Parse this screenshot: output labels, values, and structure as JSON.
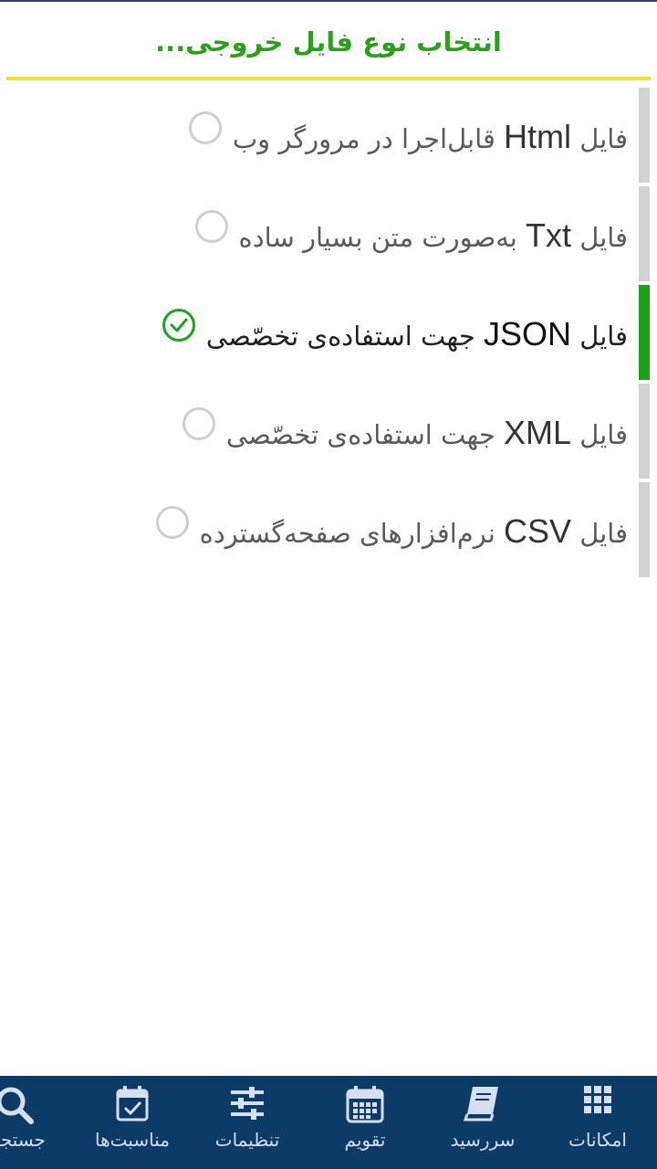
{
  "header": {
    "title": "انتخاب نوع فایل خروجی..."
  },
  "options": [
    {
      "prefix": "فایل ",
      "latin": "Html",
      "suffix": " قابل‌اجرا در مرورگر وب",
      "selected": false
    },
    {
      "prefix": "فایل ",
      "latin": "Txt",
      "suffix": " به‌صورت متن بسیار ساده",
      "selected": false
    },
    {
      "prefix": "فایل ",
      "latin": "JSON",
      "suffix": " جهت استفاده‌ی تخصّصی",
      "selected": true
    },
    {
      "prefix": "فایل ",
      "latin": "XML",
      "suffix": " جهت استفاده‌ی تخصّصی",
      "selected": false
    },
    {
      "prefix": "فایل ",
      "latin": "CSV",
      "suffix": " نرم‌افزارهای صفحه‌گسترده",
      "selected": false
    }
  ],
  "bottom_nav": {
    "items": [
      {
        "label": "امکانات",
        "icon": "grid-icon"
      },
      {
        "label": "سررسید",
        "icon": "book-icon"
      },
      {
        "label": "تقویم",
        "icon": "calendar-icon"
      },
      {
        "label": "تنظیمات",
        "icon": "sliders-icon"
      },
      {
        "label": "مناسبت‌ها",
        "icon": "calendar-check-icon"
      },
      {
        "label": "جستجو",
        "icon": "search-icon"
      }
    ]
  },
  "colors": {
    "accent_green": "#2e9e1f",
    "title_underline": "#f2de3c",
    "nav_background": "#0b3b66",
    "selected_bar": "#18a118",
    "unselected_bar": "#d2d2d2"
  }
}
